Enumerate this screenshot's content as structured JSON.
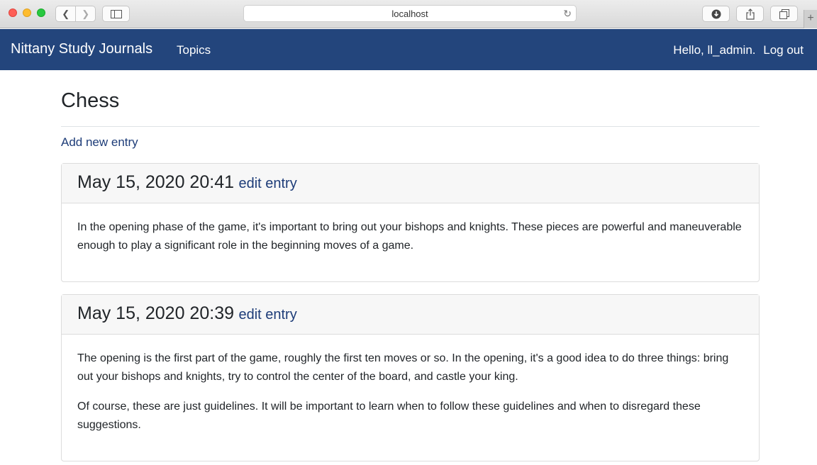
{
  "browser": {
    "url": "localhost"
  },
  "navbar": {
    "brand": "Nittany Study Journals",
    "topics_label": "Topics",
    "greeting": "Hello, ll_admin.",
    "logout_label": "Log out",
    "bg_color": "#23457c"
  },
  "page": {
    "title": "Chess",
    "add_entry_label": "Add new entry"
  },
  "entries": [
    {
      "date": "May 15, 2020 20:41",
      "edit_label": "edit entry",
      "paragraphs": [
        "In the opening phase of the game, it's important to bring out your bishops and knights. These pieces are powerful and maneuverable enough to play a significant role in the beginning moves of a game."
      ]
    },
    {
      "date": "May 15, 2020 20:39",
      "edit_label": "edit entry",
      "paragraphs": [
        "The opening is the first part of the game, roughly the first ten moves or so. In the opening, it's a good idea to do three things: bring out your bishops and knights, try to control the center of the board, and castle your king.",
        "Of course, these are just guidelines. It will be important to learn when to follow these guidelines and when to disregard these suggestions."
      ]
    }
  ]
}
